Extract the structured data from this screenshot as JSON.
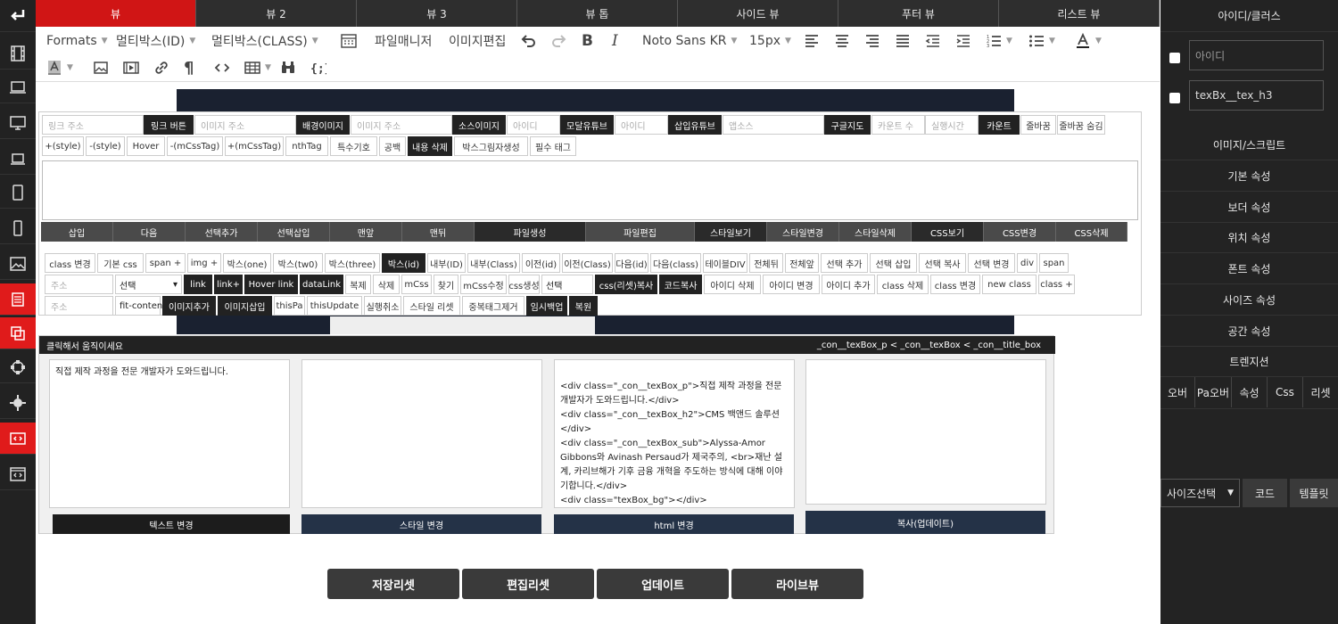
{
  "tabs": [
    "뷰",
    "뷰 2",
    "뷰 3",
    "뷰 톱",
    "사이드 뷰",
    "푸터 뷰",
    "리스트 뷰"
  ],
  "toolbar": {
    "formats": "Formats",
    "multibox_id": "멀티박스(ID)",
    "multibox_class": "멀티박스(CLASS)",
    "file_manager": "파일매니저",
    "image_edit": "이미지편집",
    "font": "Noto Sans KR",
    "size": "15px"
  },
  "panel": {
    "row1": [
      {
        "t": "링크 주소",
        "k": "i"
      },
      {
        "t": "링크 버튼",
        "k": "d"
      },
      {
        "t": "이미지 주소",
        "k": "i"
      },
      {
        "t": "배경이미지",
        "k": "d"
      },
      {
        "t": "이미지 주소",
        "k": "i"
      },
      {
        "t": "소스이미지",
        "k": "d"
      },
      {
        "t": "아이디",
        "k": "i"
      },
      {
        "t": "모달유튜브",
        "k": "d"
      },
      {
        "t": "아이디",
        "k": "i"
      },
      {
        "t": "삽입유튜브",
        "k": "d"
      },
      {
        "t": "앱소스",
        "k": "i"
      },
      {
        "t": "구글지도",
        "k": "d"
      },
      {
        "t": "카운트 수",
        "k": "i"
      },
      {
        "t": "실행시간",
        "k": "i"
      },
      {
        "t": "카운트",
        "k": "d"
      },
      {
        "t": "줄바꿈",
        "k": "b"
      },
      {
        "t": "줄바꿈 숨김",
        "k": "b"
      }
    ],
    "row2": [
      "+(style)",
      "-(style)",
      "Hover",
      "-(mCssTag)",
      "+(mCssTag)",
      "nthTag",
      "특수기호",
      "공백",
      "내용 삭제",
      "박스그림자생성",
      "필수 태그"
    ],
    "actions": [
      "삽입",
      "다음",
      "선택추가",
      "선택삽입",
      "맨앞",
      "맨뒤",
      "파일생성",
      "파일편집",
      "스타일보기",
      "스타일변경",
      "스타일삭제",
      "CSS보기",
      "CSS변경",
      "CSS삭제"
    ],
    "row3": [
      "class 변경",
      "기본 css",
      "span +",
      "img +",
      "박스(one)",
      "박스(tw0)",
      "박스(three)",
      "박스(id)",
      "내부(ID)",
      "내부(Class)",
      "이전(id)",
      "이전(Class)",
      "다음(id)",
      "다음(class)",
      "테이블DIV",
      "전체뒤",
      "전체앞",
      "선택 추가",
      "선택 삽입",
      "선택 복사",
      "선택 변경",
      "div",
      "span"
    ],
    "row4_input": "주소",
    "row4_select": "선택",
    "row4": [
      "link",
      "link+",
      "Hover link",
      "dataLink",
      "복제",
      "삭제",
      "mCss",
      "찾기",
      "mCss수정",
      "css생성"
    ],
    "row4_select2": "선택",
    "row4b": [
      "css(리셋)복사",
      "코드복사",
      "아이디 삭제",
      "아이디 변경",
      "아이디 추가",
      "class 삭제",
      "class 변경",
      "new class",
      "class +"
    ],
    "row5_input": "주소",
    "row5_select": "fit-conten",
    "row5": [
      "이미지추가",
      "이미지삽입",
      "thisPa",
      "thisUpdate",
      "실행취소",
      "스타일 리셋",
      "중복태그제거",
      "임시백업",
      "복원"
    ]
  },
  "editwin": {
    "drag_label": "클릭해서 움직이세요",
    "breadcrumb": "_con__texBox_p < _con__texBox < _con__title_box",
    "text_box": "직접 제작 과정을 전문 개발자가 도와드립니다.",
    "style_box": "",
    "html_box": "\n<div class=\"_con__texBox_p\">직접 제작 과정을 전문 개발자가 도와드립니다.</div>\n<div class=\"_con__texBox_h2\">CMS 백앤드 솔루션</div>\n<div class=\"_con__texBox_sub\">Alyssa-Amor Gibbons와 Avinash Persaud가 제국주의, <br>재난 설계, 카리브해가 기후 금융 개혁을 주도하는 방식에 대해 이야기합니다.</div>\n<div class=\"texBox_bg\"></div>",
    "copy_box": "",
    "btn_text": "텍스트 변경",
    "btn_style": "스타일 변경",
    "btn_html": "html 변경",
    "btn_copy": "복사(업데이트)"
  },
  "bottom": [
    "저장리셋",
    "편집리셋",
    "업데이트",
    "라이브뷰"
  ],
  "right": {
    "title": "아이디/클러스",
    "id_placeholder": "아이디",
    "class_value": "texBx__tex_h3",
    "sections": [
      "이미지/스크립트",
      "기본 속성",
      "보더 속성",
      "위치 속성",
      "폰트 속성",
      "사이즈 속성",
      "공간 속성",
      "트렌지션"
    ],
    "tabs": [
      "오버",
      "Pa오버",
      "속성",
      "Css",
      "리셋"
    ],
    "size_select": "사이즈선택",
    "code_btn": "코드",
    "template_btn": "템플릿"
  },
  "colors": {
    "accent": "#d01515",
    "dark": "#222222",
    "navy": "#243247"
  }
}
